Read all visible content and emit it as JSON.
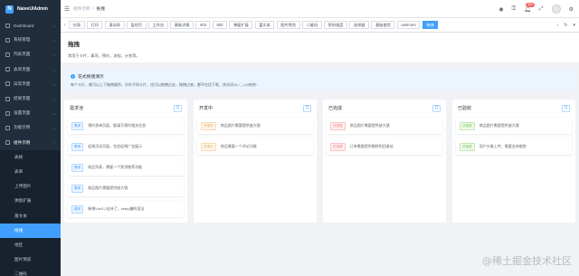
{
  "app": {
    "logo_letter": "N",
    "name": "NaiveUiAdmin"
  },
  "sidebar": {
    "items": [
      {
        "label": "Dashboard"
      },
      {
        "label": "系统管理"
      },
      {
        "label": "列表页面"
      },
      {
        "label": "表单页面"
      },
      {
        "label": "异常页面"
      },
      {
        "label": "结果页面"
      },
      {
        "label": "设置页面"
      },
      {
        "label": "功能示例"
      }
    ],
    "open_group": {
      "label": "组件示例"
    },
    "subitems": [
      {
        "label": "表格"
      },
      {
        "label": "表单"
      },
      {
        "label": "上传图片"
      },
      {
        "label": "弹窗扩展"
      },
      {
        "label": "富文本"
      },
      {
        "label": "拖拽",
        "active": true
      },
      {
        "label": "地区"
      },
      {
        "label": "图片预览"
      },
      {
        "label": "二维码"
      }
    ]
  },
  "header": {
    "breadcrumb": [
      "组件示例",
      "拖拽"
    ],
    "notification_count": "10+"
  },
  "tags": [
    "仪表",
    "打印",
    "滚动条",
    "监控页",
    "工作台",
    "基础详情",
    "403",
    "500",
    "弹窗扩展",
    "富文本",
    "图片预览",
    "二维码",
    "密码强度",
    "选择器",
    "基础使用",
    "useForm",
    "拖拽"
  ],
  "active_tag": "拖拽",
  "page": {
    "title": "拖拽",
    "description": "常用于卡片，事项，预约，流程，计划等。"
  },
  "info": {
    "title": "花式拖拽演示",
    "description": "每个卡片，都可以上下拖拽顺序，另外不同卡片，也可以拖拽过去，拖拽过来，都不在话下呢，快试试O(∩_∩)O哈哈~"
  },
  "board": {
    "columns": [
      {
        "title": "需求池",
        "count": "月",
        "cards": [
          {
            "tag": "需求",
            "tag_type": "info",
            "text": "预约表单页面，能填写预约相关信息"
          },
          {
            "tag": "需求",
            "tag_type": "info",
            "text": "促销活动页面，包含促销广告展示"
          },
          {
            "tag": "需求",
            "tag_type": "info",
            "text": "商品列表，需要一个到顶推荐功能"
          },
          {
            "tag": "需求",
            "tag_type": "info",
            "text": "商品图片需要提供放大镜"
          },
          {
            "tag": "需求",
            "tag_type": "info",
            "text": "新增Vue3.2支持了，setup糖的语法"
          }
        ]
      },
      {
        "title": "开发中",
        "count": "月",
        "cards": [
          {
            "tag": "开发中",
            "tag_type": "warning",
            "text": "商品图片需要提供放大镜"
          },
          {
            "tag": "开发中",
            "tag_type": "warning",
            "text": "商品需要一个评论功能"
          }
        ]
      },
      {
        "title": "已完成",
        "count": "月",
        "cards": [
          {
            "tag": "已完成",
            "tag_type": "danger",
            "text": "商品图片需要提供放大镜"
          },
          {
            "tag": "已完成",
            "tag_type": "danger",
            "text": "订单需要提供删除到回收站"
          }
        ]
      },
      {
        "title": "已验收",
        "count": "月",
        "cards": [
          {
            "tag": "已验收",
            "tag_type": "success",
            "text": "商品图片需要提供放大镜"
          },
          {
            "tag": "已验收",
            "tag_type": "success",
            "text": "用户头像上传，需要支持裁剪"
          }
        ]
      }
    ]
  },
  "tag_colors": {
    "info": {
      "fg": "#409eff",
      "bg": "#ecf5ff",
      "border": "#b3d8ff"
    },
    "warning": {
      "fg": "#e6a23c",
      "bg": "#fdf6ec",
      "border": "#f5dab1"
    },
    "danger": {
      "fg": "#f56c6c",
      "bg": "#fef0f0",
      "border": "#fbc4c4"
    },
    "success": {
      "fg": "#67c23a",
      "bg": "#f0f9eb",
      "border": "#c2e7b0"
    }
  },
  "watermark": "@稀土掘金技术社区"
}
